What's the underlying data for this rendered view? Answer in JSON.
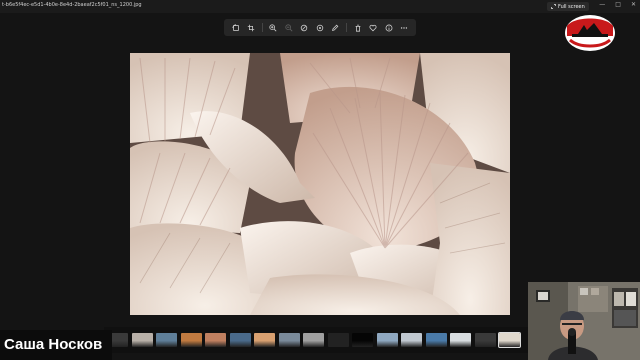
{
  "window": {
    "title": "t-b6e5f4ec-e5d1-4b0e-8e4d-2baeaf2c5f01_ns_1200.jpg",
    "fullscreen_label": "Full screen",
    "minimize_glyph": "—",
    "maximize_glyph": "□",
    "close_glyph": "✕"
  },
  "toolbar": {
    "icons": [
      "rotate-icon",
      "crop-icon",
      "zoom-in-icon",
      "zoom-out-icon",
      "erase-icon",
      "filter-icon",
      "edit-icon",
      "delete-icon",
      "favorite-icon",
      "info-icon",
      "more-icon"
    ]
  },
  "photo": {
    "subject": "seashells",
    "palette": [
      "#e9ddd2",
      "#c9a998",
      "#f4ece4",
      "#8a6f63"
    ]
  },
  "filmstrip": {
    "thumb_count": 17,
    "selected_index": 16,
    "thumb_colors": [
      "#3a3a3a",
      "#b8b0a8",
      "#5f7f99",
      "#c07a40",
      "#c08060",
      "#4a6a8a",
      "#d8a070",
      "#7a8a9a",
      "#a0a0a0",
      "#222",
      "#050505",
      "#8fa8c0",
      "#c0c8d0",
      "#4a7aa8",
      "#d8dde0",
      "#3a3a3a",
      "#e0d8cc"
    ]
  },
  "overlay": {
    "presenter_name": "Саша Носков"
  },
  "colors": {
    "background": "#141414",
    "toolbar": "#262626",
    "logo_red": "#c8191b"
  }
}
